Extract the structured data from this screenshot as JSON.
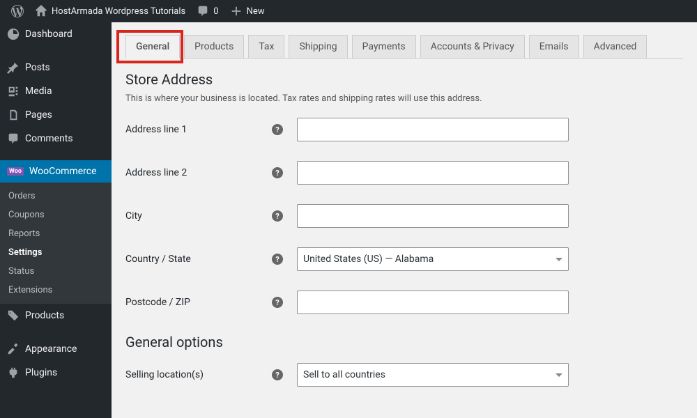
{
  "topbar": {
    "site_name": "HostArmada Wordpress Tutorials",
    "comments_count": "0",
    "new_label": "New"
  },
  "sidebar": {
    "items": [
      {
        "label": "Dashboard"
      },
      {
        "label": "Posts"
      },
      {
        "label": "Media"
      },
      {
        "label": "Pages"
      },
      {
        "label": "Comments"
      },
      {
        "label": "WooCommerce"
      },
      {
        "label": "Products"
      },
      {
        "label": "Appearance"
      },
      {
        "label": "Plugins"
      }
    ],
    "submenu": {
      "items": [
        {
          "label": "Orders"
        },
        {
          "label": "Coupons"
        },
        {
          "label": "Reports"
        },
        {
          "label": "Settings"
        },
        {
          "label": "Status"
        },
        {
          "label": "Extensions"
        }
      ]
    }
  },
  "tabs": {
    "items": [
      {
        "label": "General"
      },
      {
        "label": "Products"
      },
      {
        "label": "Tax"
      },
      {
        "label": "Shipping"
      },
      {
        "label": "Payments"
      },
      {
        "label": "Accounts & Privacy"
      },
      {
        "label": "Emails"
      },
      {
        "label": "Advanced"
      }
    ]
  },
  "section": {
    "store_address_title": "Store Address",
    "store_address_desc": "This is where your business is located. Tax rates and shipping rates will use this address.",
    "general_options_title": "General options"
  },
  "fields": {
    "address1": {
      "label": "Address line 1",
      "value": ""
    },
    "address2": {
      "label": "Address line 2",
      "value": ""
    },
    "city": {
      "label": "City",
      "value": ""
    },
    "country_state": {
      "label": "Country / State",
      "value": "United States (US) — Alabama"
    },
    "postcode": {
      "label": "Postcode / ZIP",
      "value": ""
    },
    "selling_locations": {
      "label": "Selling location(s)",
      "value": "Sell to all countries"
    }
  }
}
